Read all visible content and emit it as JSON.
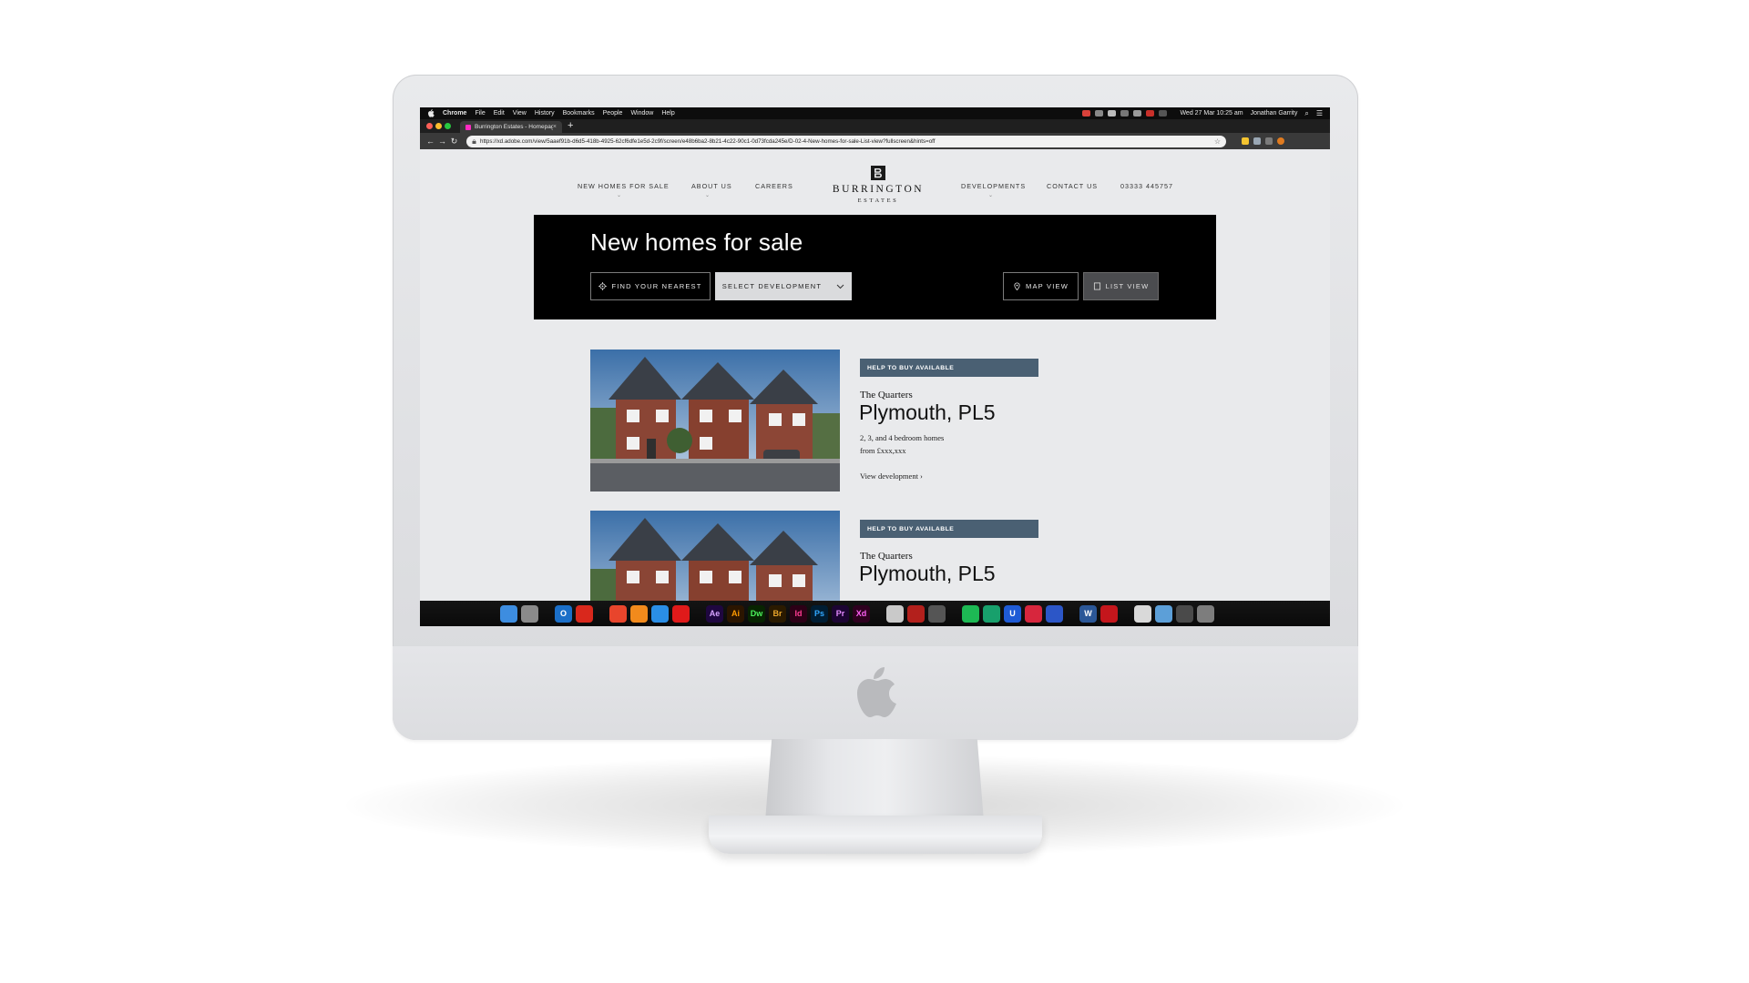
{
  "menubar": {
    "items": [
      "Chrome",
      "File",
      "Edit",
      "View",
      "History",
      "Bookmarks",
      "People",
      "Window",
      "Help"
    ],
    "clock": "Wed 27 Mar  10:25 am",
    "user": "Jonathan Garrity"
  },
  "browser": {
    "tab_title": "Burrington Estates - Homepag",
    "url": "https://xd.adobe.com/view/5aaef91b-d6d5-418b-4925-62cf6dfe1e5d-2c9f/screen/e48b6ba2-8b21-4c22-90c1-0d73fcda245e/D-02-4-New-homes-for-sale-List-view?fullscreen&hints=off"
  },
  "site": {
    "nav_left": [
      "NEW HOMES FOR SALE",
      "ABOUT US",
      "CAREERS"
    ],
    "nav_right": [
      "DEVELOPMENTS",
      "CONTACT US",
      "03333 445757"
    ],
    "logo_name": "BURRINGTON",
    "logo_sub": "ESTATES",
    "hero": {
      "title": "New homes for sale",
      "find_nearest": "FIND YOUR NEAREST",
      "select_development": "SELECT DEVELOPMENT",
      "map_view": "MAP VIEW",
      "list_view": "LIST VIEW"
    },
    "developments": [
      {
        "badge": "HELP TO BUY AVAILABLE",
        "name": "The Quarters",
        "location": "Plymouth, PL5",
        "bedrooms": "2, 3, and 4 bedroom homes",
        "price": "from £xxx,xxx",
        "link": "View development  ›"
      },
      {
        "badge": "HELP TO BUY AVAILABLE",
        "name": "The Quarters",
        "location": "Plymouth, PL5"
      }
    ]
  },
  "dock": {
    "apps": [
      {
        "icon": "finder-icon",
        "label": "",
        "bg": "#3d8de0",
        "fg": "#fff"
      },
      {
        "icon": "launchpad-icon",
        "label": "",
        "bg": "#8a8a8a",
        "fg": "#fff"
      },
      {
        "icon": "outlook-icon",
        "label": "O",
        "bg": "#1b6fc8",
        "fg": "#fff"
      },
      {
        "icon": "opera-icon",
        "label": "",
        "bg": "#d9281c",
        "fg": "#fff"
      },
      {
        "icon": "chrome-icon",
        "label": "",
        "bg": "#e8452c",
        "fg": "#fff"
      },
      {
        "icon": "firefox-icon",
        "label": "",
        "bg": "#f28a1c",
        "fg": "#fff"
      },
      {
        "icon": "safari-icon",
        "label": "",
        "bg": "#2a8ee6",
        "fg": "#fff"
      },
      {
        "icon": "opera-alt-icon",
        "label": "",
        "bg": "#e01a1a",
        "fg": "#fff"
      },
      {
        "icon": "after-effects-icon",
        "label": "Ae",
        "bg": "#1f0740",
        "fg": "#d6a3ff"
      },
      {
        "icon": "illustrator-icon",
        "label": "Ai",
        "bg": "#2b1500",
        "fg": "#ff9a00"
      },
      {
        "icon": "dreamweaver-icon",
        "label": "Dw",
        "bg": "#072401",
        "fg": "#4cf25c"
      },
      {
        "icon": "bridge-icon",
        "label": "Br",
        "bg": "#2a1a00",
        "fg": "#e8a52b"
      },
      {
        "icon": "indesign-icon",
        "label": "Id",
        "bg": "#2c0016",
        "fg": "#ff3d93"
      },
      {
        "icon": "photoshop-icon",
        "label": "Ps",
        "bg": "#001d33",
        "fg": "#31a8ff"
      },
      {
        "icon": "premiere-icon",
        "label": "Pr",
        "bg": "#1c0433",
        "fg": "#e48bff"
      },
      {
        "icon": "xd-icon",
        "label": "Xd",
        "bg": "#2e001f",
        "fg": "#ff61f6"
      },
      {
        "icon": "app-icon",
        "label": "",
        "bg": "#c9c9c9",
        "fg": "#fff"
      },
      {
        "icon": "photobooth-icon",
        "label": "",
        "bg": "#b3201c",
        "fg": "#fff"
      },
      {
        "icon": "app-icon",
        "label": "",
        "bg": "#555",
        "fg": "#fff"
      },
      {
        "icon": "spotify-icon",
        "label": "",
        "bg": "#1db954",
        "fg": "#fff"
      },
      {
        "icon": "app-icon",
        "label": "",
        "bg": "#18a06c",
        "fg": "#fff"
      },
      {
        "icon": "app-icon",
        "label": "U",
        "bg": "#1f5bd6",
        "fg": "#fff"
      },
      {
        "icon": "app-icon",
        "label": "",
        "bg": "#d7263d",
        "fg": "#fff"
      },
      {
        "icon": "app-icon",
        "label": "",
        "bg": "#2c56c7",
        "fg": "#fff"
      },
      {
        "icon": "word-icon",
        "label": "W",
        "bg": "#2b5797",
        "fg": "#fff"
      },
      {
        "icon": "app-icon",
        "label": "",
        "bg": "#c4161c",
        "fg": "#fff"
      },
      {
        "icon": "documents-icon",
        "label": "",
        "bg": "#d9d9d9",
        "fg": "#333"
      },
      {
        "icon": "folder-icon",
        "label": "",
        "bg": "#5c9fd8",
        "fg": "#fff"
      },
      {
        "icon": "app-icon",
        "label": "",
        "bg": "#4a4a4a",
        "fg": "#fff"
      },
      {
        "icon": "trash-icon",
        "label": "",
        "bg": "#7d7d7d",
        "fg": "#fff"
      }
    ]
  }
}
